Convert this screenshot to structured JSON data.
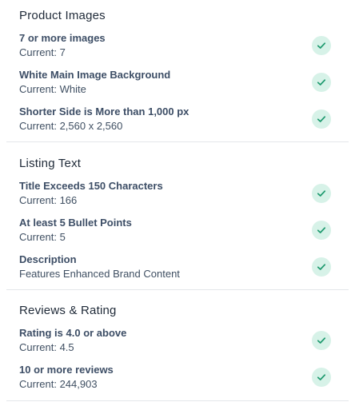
{
  "sections": [
    {
      "title": "Product Images",
      "items": [
        {
          "label": "7 or more images",
          "value": "Current: 7",
          "status": "passed"
        },
        {
          "label": "White Main Image Background",
          "value": "Current: White",
          "status": "passed"
        },
        {
          "label": "Shorter Side is More than 1,000 px",
          "value": "Current: 2,560 x 2,560",
          "status": "passed"
        }
      ]
    },
    {
      "title": "Listing Text",
      "items": [
        {
          "label": "Title Exceeds 150 Characters",
          "value": "Current: 166",
          "status": "passed"
        },
        {
          "label": "At least 5 Bullet Points",
          "value": "Current: 5",
          "status": "passed"
        },
        {
          "label": "Description",
          "value": "Features Enhanced Brand Content",
          "status": "passed"
        }
      ]
    },
    {
      "title": "Reviews & Rating",
      "items": [
        {
          "label": "Rating is 4.0 or above",
          "value": "Current: 4.5",
          "status": "passed"
        },
        {
          "label": "10 or more reviews",
          "value": "Current: 244,903",
          "status": "passed"
        }
      ]
    }
  ],
  "icons": {
    "status_passed": "check-circle-icon"
  },
  "colors": {
    "check_background": "#d7f2e8",
    "check_mark": "#1f9a6f",
    "divider": "#e4e7ea"
  }
}
